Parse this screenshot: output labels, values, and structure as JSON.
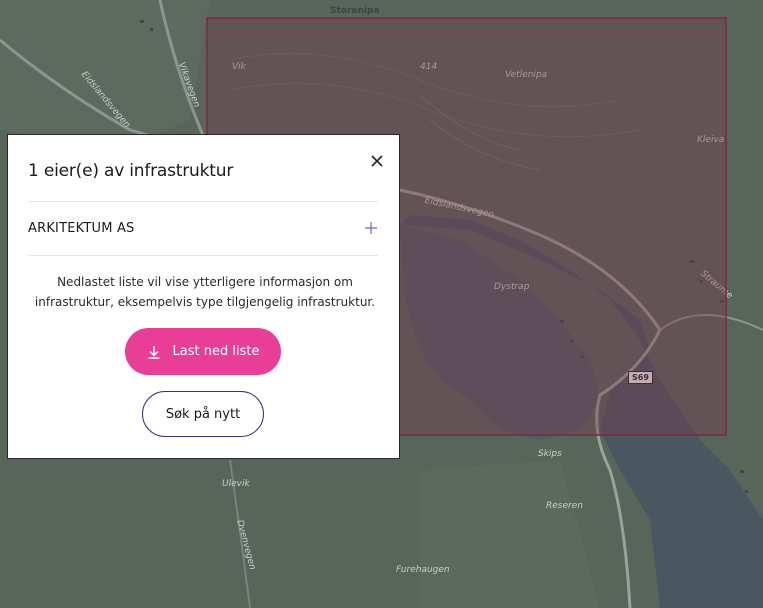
{
  "map": {
    "labels": {
      "peak_top": "Storenipa",
      "road_left": "Eidslandsvegen",
      "road_vikavegen": "Vikavegen",
      "elev_1": "414",
      "peak_vetlenipa": "Vetlenipa",
      "place_kleiva": "Kleiva",
      "road_mid": "Eidslandsvegen",
      "place_dystrap": "Dystrap",
      "place_straume": "Straume",
      "place_skips": "Skips",
      "place_ulevik": "Ulevik",
      "place_reseren": "Reseren",
      "road_dvenvegen": "Dvenvegen",
      "place_furehaugen": "Furehaugen",
      "elev_vik": "Vik"
    },
    "road_badge": "S69",
    "selection_color": "#7a3650"
  },
  "modal": {
    "title": "1 eier(e) av infrastruktur",
    "owner": "ARKITEKTUM AS",
    "info": "Nedlastet liste vil vise ytterligere informasjon om infrastruktur, eksempelvis type tilgjengelig infrastruktur.",
    "download_label": "Last ned liste",
    "search_again_label": "Søk på nytt",
    "accent_color": "#e83e98",
    "outline_color": "#3d2b7a"
  }
}
